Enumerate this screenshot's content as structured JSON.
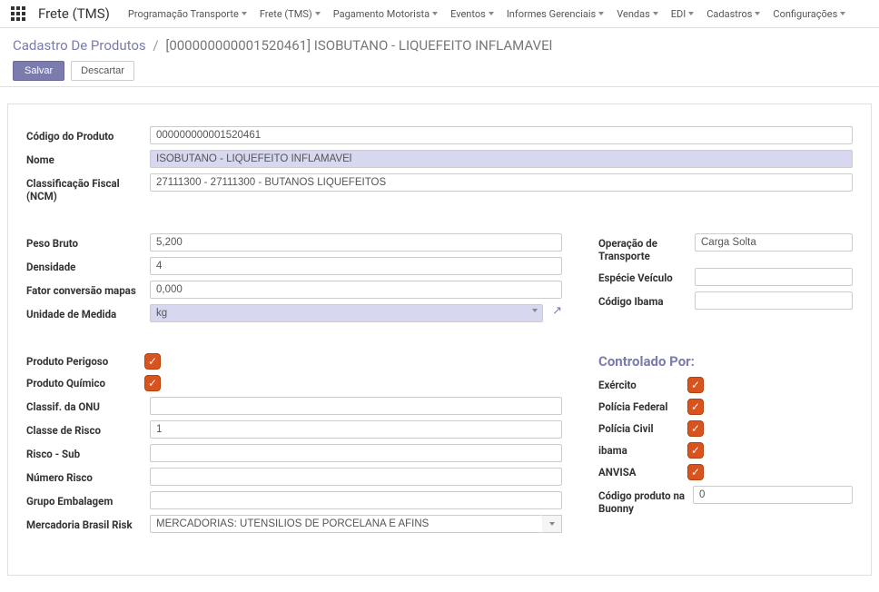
{
  "brand": "Frete (TMS)",
  "nav": {
    "items": [
      "Programação Transporte",
      "Frete (TMS)",
      "Pagamento Motorista",
      "Eventos",
      "Informes Gerenciais",
      "Vendas",
      "EDI",
      "Cadastros",
      "Configurações"
    ]
  },
  "breadcrumb": {
    "parent": "Cadastro De Produtos",
    "current": "[000000000001520461] ISOBUTANO - LIQUEFEITO INFLAMAVEl"
  },
  "buttons": {
    "save": "Salvar",
    "discard": "Descartar"
  },
  "labels": {
    "codigo": "Código do Produto",
    "nome": "Nome",
    "ncm": "Classificação Fiscal (NCM)",
    "peso": "Peso Bruto",
    "densidade": "Densidade",
    "fator": "Fator conversão mapas",
    "unidade": "Unidade de Medida",
    "operacao": "Operação de Transporte",
    "especie": "Espécie Veículo",
    "ibama": "Código Ibama",
    "perigoso": "Produto Perigoso",
    "quimico": "Produto Químico",
    "classifOnu": "Classif. da ONU",
    "classeRisco": "Classe de Risco",
    "riscoSub": "Risco - Sub",
    "numeroRisco": "Número Risco",
    "grupoEmb": "Grupo Embalagem",
    "brasilRisk": "Mercadoria Brasil Risk",
    "controlado": "Controlado Por:",
    "exercito": "Exército",
    "pf": "Polícia Federal",
    "pc": "Polícia Civil",
    "ibamaChk": "ibama",
    "anvisa": "ANVISA",
    "buonny": "Código produto na Buonny"
  },
  "values": {
    "codigo": "000000000001520461",
    "nome": "ISOBUTANO - LIQUEFEITO INFLAMAVEl",
    "ncm": "27111300 - 27111300 - BUTANOS LIQUEFEITOS",
    "peso": "5,200",
    "densidade": "4",
    "fator": "0,000",
    "unidade": "kg",
    "operacao": "Carga Solta",
    "especie": "",
    "ibama": "",
    "classifOnu": "",
    "classeRisco": "1",
    "riscoSub": "",
    "numeroRisco": "",
    "grupoEmb": "",
    "brasilRisk": "MERCADORIAS: UTENSÍLIOS DE PORCELANA E AFINS",
    "buonny": "0"
  },
  "checks": {
    "perigoso": true,
    "quimico": true,
    "exercito": true,
    "pf": true,
    "pc": true,
    "ibama": true,
    "anvisa": true
  }
}
